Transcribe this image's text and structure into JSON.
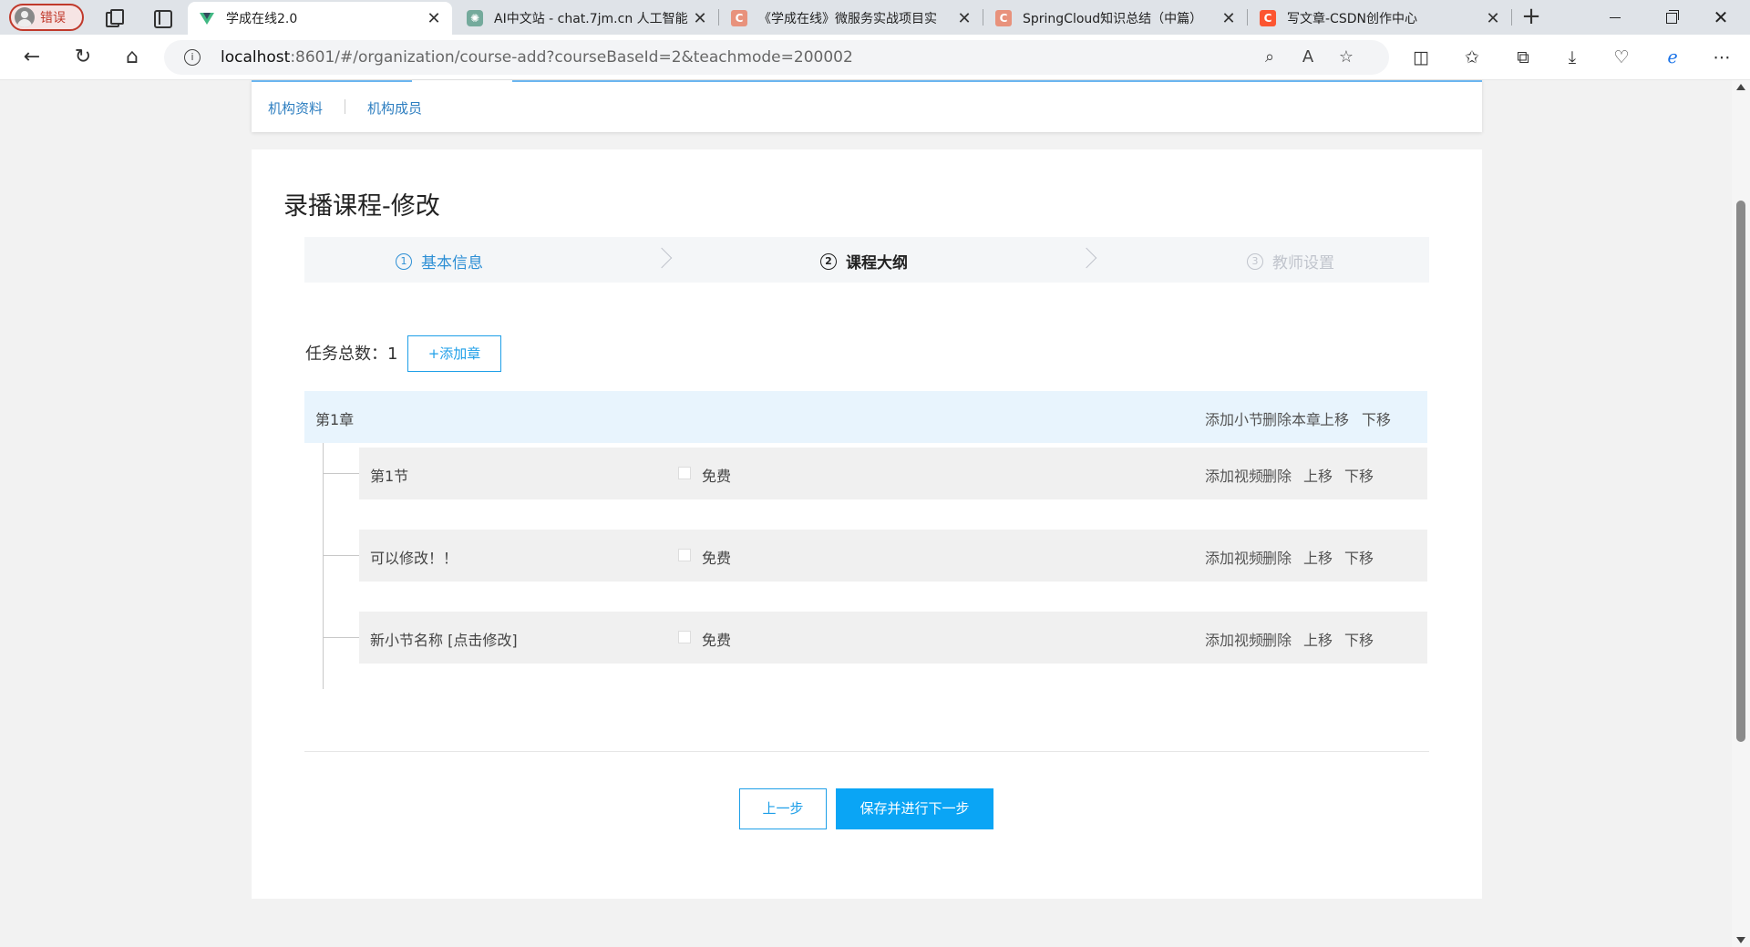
{
  "browser": {
    "profile_label": "错误",
    "tabs": [
      {
        "title": "学成在线2.0",
        "favicon": "vue-icon"
      },
      {
        "title": "AI中文站 - chat.7jm.cn 人工智能",
        "favicon": "chatgpt-icon"
      },
      {
        "title": "《学成在线》微服务实战项目实",
        "favicon": "csdn-icon"
      },
      {
        "title": "SpringCloud知识总结（中篇）",
        "favicon": "csdn-icon"
      },
      {
        "title": "写文章-CSDN创作中心",
        "favicon": "csdn-icon"
      }
    ],
    "address": {
      "host": "localhost",
      "rest": ":8601/#/organization/course-add?courseBaseId=2&teachmode=200002"
    }
  },
  "subnav": {
    "items": [
      "机构资料",
      "机构成员"
    ]
  },
  "page": {
    "title": "录播课程-修改"
  },
  "steps": [
    {
      "num": "1",
      "label": "基本信息",
      "state": "done"
    },
    {
      "num": "2",
      "label": "课程大纲",
      "state": "active"
    },
    {
      "num": "3",
      "label": "教师设置",
      "state": "pending"
    }
  ],
  "tasks": {
    "label": "任务总数：",
    "count": "1",
    "add_chapter_label": "+添加章"
  },
  "chapter": {
    "name": "第1章",
    "actions": [
      "添加小节",
      "删除本章",
      "上移",
      "下移"
    ]
  },
  "sections": [
    {
      "name": "第1节",
      "free_label": "免费",
      "free_checked": false,
      "actions": [
        "添加视频",
        "删除",
        "上移",
        "下移"
      ]
    },
    {
      "name": "可以修改！！",
      "free_label": "免费",
      "free_checked": false,
      "actions": [
        "添加视频",
        "删除",
        "上移",
        "下移"
      ]
    },
    {
      "name": "新小节名称 [点击修改]",
      "free_label": "免费",
      "free_checked": false,
      "actions": [
        "添加视频",
        "删除",
        "上移",
        "下移"
      ]
    }
  ],
  "footer": {
    "prev_label": "上一步",
    "next_label": "保存并进行下一步"
  },
  "colors": {
    "accent": "#0aa5f5",
    "link": "#2d7ec0",
    "chapter_bg": "#e8f4fd"
  }
}
